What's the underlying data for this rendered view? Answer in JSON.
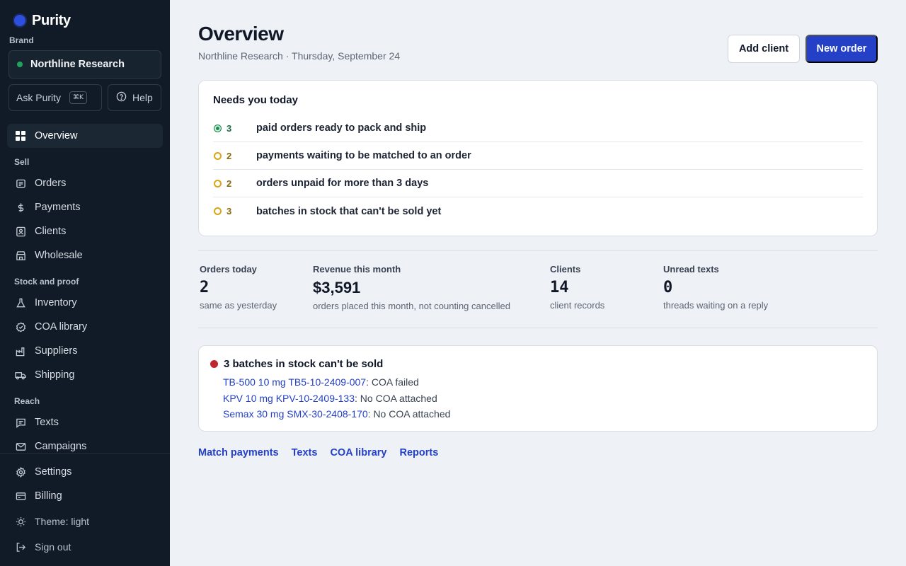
{
  "app": {
    "name": "Purity"
  },
  "sidebar": {
    "brand_label": "Brand",
    "brand_name": "Northline Research",
    "ask_label": "Ask Purity",
    "ask_shortcut": "⌘K",
    "help_label": "Help",
    "overview_label": "Overview",
    "sections": {
      "sell": "Sell",
      "stock": "Stock and proof",
      "reach": "Reach"
    },
    "sell_items": [
      "Orders",
      "Payments",
      "Clients",
      "Wholesale"
    ],
    "stock_items": [
      "Inventory",
      "COA library",
      "Suppliers",
      "Shipping"
    ],
    "reach_items": [
      "Texts",
      "Campaigns"
    ],
    "settings_label": "Settings",
    "billing_label": "Billing",
    "theme_label": "Theme: light",
    "signout_label": "Sign out"
  },
  "header": {
    "title": "Overview",
    "subtitle": "Northline Research · Thursday, September 24",
    "add_client_label": "Add client",
    "new_order_label": "New order"
  },
  "today": {
    "title": "Needs you today",
    "items": [
      {
        "count": "3",
        "label": "paid orders ready to pack and ship",
        "status": "green"
      },
      {
        "count": "2",
        "label": "payments waiting to be matched to an order",
        "status": "amber"
      },
      {
        "count": "2",
        "label": "orders unpaid for more than 3 days",
        "status": "amber"
      },
      {
        "count": "3",
        "label": "batches in stock that can't be sold yet",
        "status": "amber"
      }
    ]
  },
  "stats": [
    {
      "title": "Orders today",
      "value": "2",
      "sub": "same as yesterday"
    },
    {
      "title": "Revenue this month",
      "value": "$3,591",
      "sub": "orders placed this month, not counting cancelled"
    },
    {
      "title": "Clients",
      "value": "14",
      "sub": "client records"
    },
    {
      "title": "Unread texts",
      "value": "0",
      "sub": "threads waiting on a reply"
    }
  ],
  "alert": {
    "title": "3 batches in stock can't be sold",
    "lines": [
      {
        "link": "TB-500 10 mg TB5-10-2409-007",
        "reason": ": COA failed"
      },
      {
        "link": "KPV 10 mg KPV-10-2409-133",
        "reason": ": No COA attached"
      },
      {
        "link": "Semax 30 mg SMX-30-2408-170",
        "reason": ": No COA attached"
      }
    ]
  },
  "quick_links": [
    "Match payments",
    "Texts",
    "COA library",
    "Reports"
  ],
  "colors": {
    "sidebar_bg": "#111b27",
    "accent": "#2340c7",
    "status_green": "#1f8a52",
    "status_amber": "#d9a514",
    "status_red": "#c0262e"
  }
}
